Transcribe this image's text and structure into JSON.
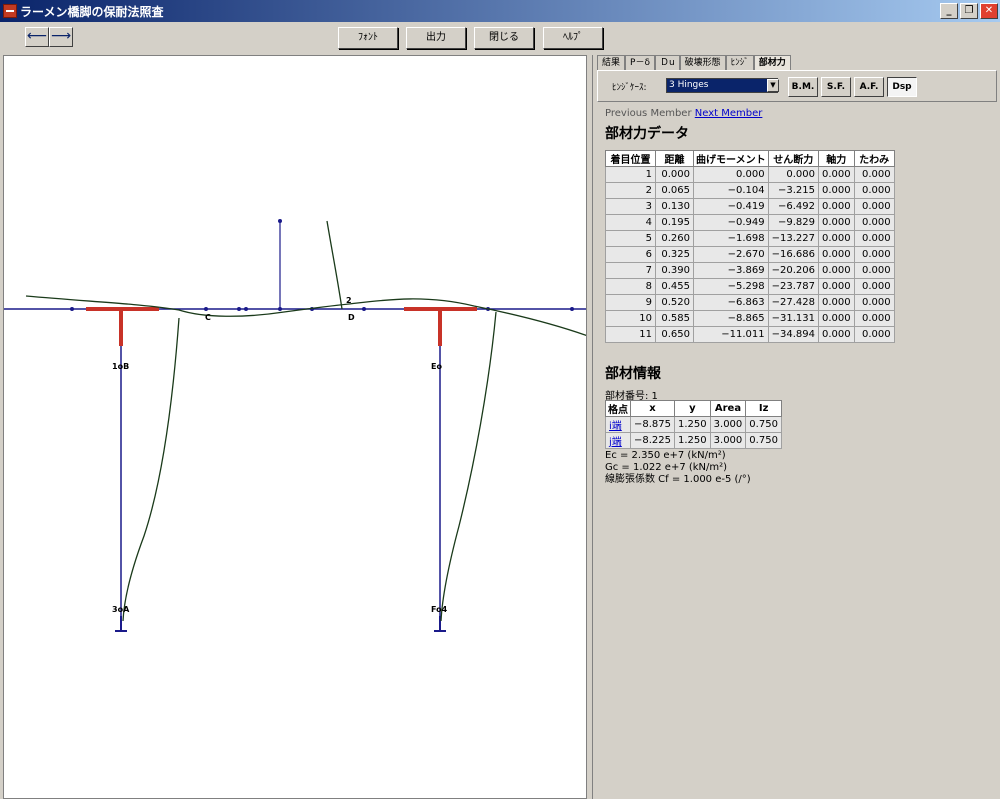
{
  "window": {
    "title": "ラーメン橋脚の保耐法照査",
    "controls": [
      "_",
      "❐",
      "✕"
    ]
  },
  "toolbar": {
    "back": "⟵",
    "forward": "⟶",
    "font": "ﾌｫﾝﾄ",
    "output": "出力",
    "close": "閉じる",
    "help": "ﾍﾙﾌﾟ"
  },
  "tabs": [
    "結果",
    "P－δ",
    "Ｄu",
    "破壊形態",
    "ﾋﾝｼﾞ",
    "部材力"
  ],
  "hinge": {
    "label": "ﾋﾝｼﾞｹｰｽ:",
    "value": "3 Hinges",
    "buttons": [
      "B.M.",
      "S.F.",
      "A.F.",
      "Dsp"
    ],
    "active": "Dsp"
  },
  "member_nav": {
    "previous": "Previous Member",
    "next": "Next Member"
  },
  "forces": {
    "title": "部材力データ",
    "headers": [
      "着目位置",
      "距離",
      "曲げモーメント",
      "せん断力",
      "軸力",
      "たわみ"
    ],
    "rows": [
      [
        "1",
        "0.000",
        "0.000",
        "0.000",
        "0.000",
        "0.000"
      ],
      [
        "2",
        "0.065",
        "−0.104",
        "−3.215",
        "0.000",
        "0.000"
      ],
      [
        "3",
        "0.130",
        "−0.419",
        "−6.492",
        "0.000",
        "0.000"
      ],
      [
        "4",
        "0.195",
        "−0.949",
        "−9.829",
        "0.000",
        "0.000"
      ],
      [
        "5",
        "0.260",
        "−1.698",
        "−13.227",
        "0.000",
        "0.000"
      ],
      [
        "6",
        "0.325",
        "−2.670",
        "−16.686",
        "0.000",
        "0.000"
      ],
      [
        "7",
        "0.390",
        "−3.869",
        "−20.206",
        "0.000",
        "0.000"
      ],
      [
        "8",
        "0.455",
        "−5.298",
        "−23.787",
        "0.000",
        "0.000"
      ],
      [
        "9",
        "0.520",
        "−6.863",
        "−27.428",
        "0.000",
        "0.000"
      ],
      [
        "10",
        "0.585",
        "−8.865",
        "−31.131",
        "0.000",
        "0.000"
      ],
      [
        "11",
        "0.650",
        "−11.011",
        "−34.894",
        "0.000",
        "0.000"
      ]
    ]
  },
  "member_info": {
    "title": "部材情報",
    "number": "部材番号: 1",
    "headers": [
      "格点",
      "x",
      "y",
      "Area",
      "Iz"
    ],
    "rows": [
      [
        "i端",
        "−8.875",
        "1.250",
        "3.000",
        "0.750"
      ],
      [
        "j端",
        "−8.225",
        "1.250",
        "3.000",
        "0.750"
      ]
    ],
    "ec": "Ec = 2.350 e+7 (kN/m²)",
    "gc": "Gc = 1.022 e+7 (kN/m²)",
    "cte": "線膨張係数 Cf = 1.000 e-5 (/°)"
  },
  "diagram_labels": {
    "node_1b": "1oB",
    "node_3a": "3oA",
    "node_e": "Eo",
    "node_f": "Fo4",
    "node_c": "C",
    "node_d": "D",
    "node_2": "2"
  },
  "colors": {
    "frame": "#1a1a8a",
    "deflection": "#1a3a1a",
    "beam_highlight": "#c83228"
  }
}
